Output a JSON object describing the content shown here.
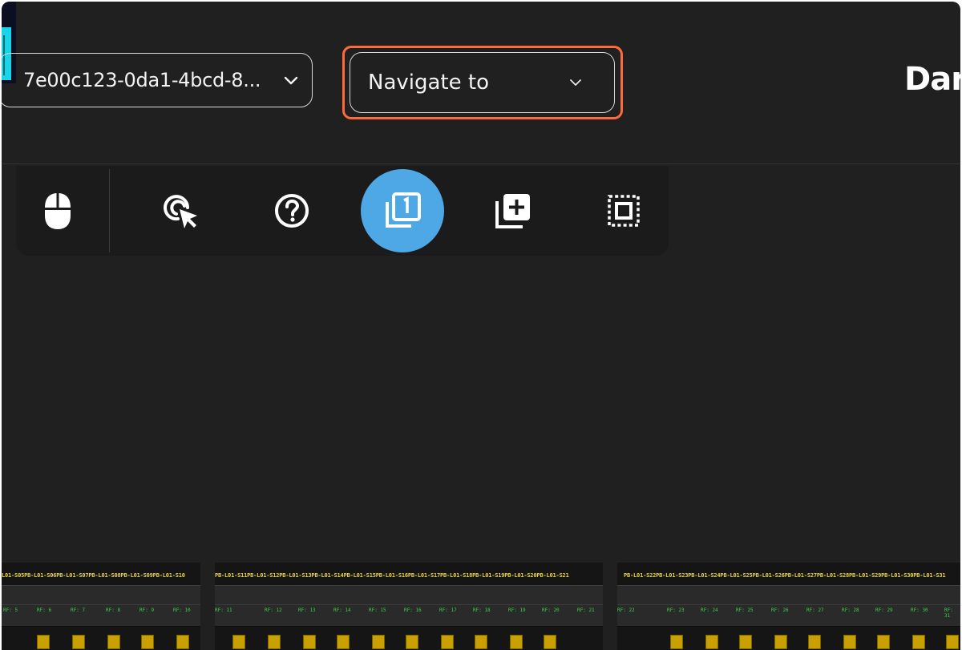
{
  "header": {
    "session_select_value": "7e00c123-0da1-4bcd-8...",
    "navigate_placeholder": "Navigate to",
    "brand_text": "Dark"
  },
  "toolbar": {
    "tools": [
      {
        "name": "mouse-icon",
        "active": false
      },
      {
        "name": "click-cursor-icon",
        "active": false
      },
      {
        "name": "help-icon",
        "active": false
      },
      {
        "name": "single-page-icon",
        "active": true
      },
      {
        "name": "add-copy-icon",
        "active": false
      },
      {
        "name": "select-area-icon",
        "active": false
      }
    ],
    "active_color": "#4ea8e6"
  },
  "highlight_color": "#ff6a3d",
  "racks": [
    {
      "labels": "L01-S05PB-L01-S06PB-L01-S07PB-L01-S08PB-L01-S09PB-L01-S10",
      "rf": [
        "RF: 5",
        "RF: 6",
        "RF: 7",
        "RF: 8",
        "RF: 9",
        "RF: 10"
      ]
    },
    {
      "labels": "PB-L01-S11PB-L01-S12PB-L01-S13PB-L01-S14PB-L01-S15PB-L01-S16PB-L01-S17PB-L01-S18PB-L01-S19PB-L01-S20PB-L01-S21",
      "rf": [
        "RF: 11",
        "RF: 12",
        "RF: 13",
        "RF: 14",
        "RF: 15",
        "RF: 16",
        "RF: 17",
        "RF: 18",
        "RF: 19",
        "RF: 20",
        "RF: 21"
      ]
    },
    {
      "labels": "PB-L01-S22PB-L01-S23PB-L01-S24PB-L01-S25PB-L01-S26PB-L01-S27PB-L01-S28PB-L01-S29PB-L01-S30PB-L01-S31",
      "rf": [
        "RF: 22",
        "RF: 23",
        "RF: 24",
        "RF: 25",
        "RF: 26",
        "RF: 27",
        "RF: 28",
        "RF: 29",
        "RF: 30",
        "RF: 31"
      ]
    }
  ]
}
